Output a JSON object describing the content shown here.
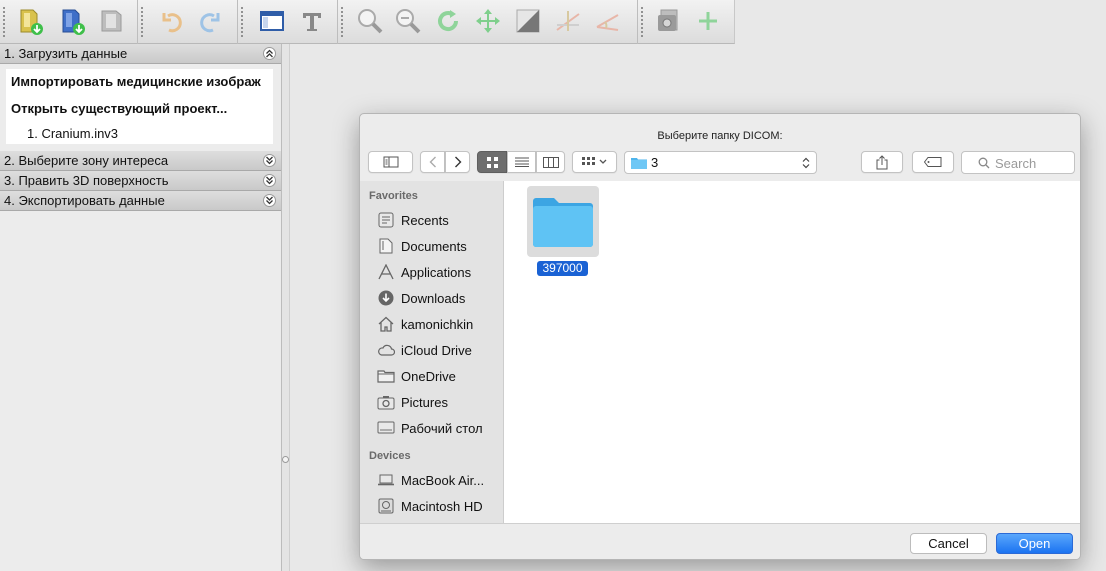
{
  "toolbar": {
    "groups": [
      {
        "icons": [
          "import-images-icon",
          "open-project-icon",
          "save-project-icon"
        ]
      },
      {
        "icons": [
          "undo-icon",
          "redo-icon"
        ]
      },
      {
        "icons": [
          "show-panel-icon",
          "text-icon"
        ]
      },
      {
        "icons": [
          "zoom-in-icon",
          "zoom-out-icon",
          "rotate-icon",
          "pan-icon",
          "contrast-icon",
          "measure-distance-icon",
          "measure-angle-icon"
        ]
      },
      {
        "icons": [
          "screenshot-icon",
          "add-icon"
        ]
      }
    ]
  },
  "sidebar": {
    "sections": [
      {
        "label": "1. Загрузить данные",
        "expanded": true
      },
      {
        "label": "2. Выберите зону интереса",
        "expanded": false
      },
      {
        "label": "3. Править 3D поверхность",
        "expanded": false
      },
      {
        "label": "4. Экспортировать данные",
        "expanded": false
      }
    ],
    "panel1": {
      "import_label": "Импортировать медицинские изображ",
      "open_project_label": "Открыть существующий проект...",
      "recent_file": "1. Cranium.inv3"
    }
  },
  "dialog": {
    "title": "Выберите папку DICOM:",
    "current_folder": "3",
    "search_placeholder": "Search",
    "favorites_header": "Favorites",
    "favorites": [
      {
        "icon": "recents-icon",
        "label": "Recents"
      },
      {
        "icon": "documents-icon",
        "label": "Documents"
      },
      {
        "icon": "applications-icon",
        "label": "Applications"
      },
      {
        "icon": "downloads-icon",
        "label": "Downloads"
      },
      {
        "icon": "home-icon",
        "label": "kamonichkin"
      },
      {
        "icon": "icloud-icon",
        "label": "iCloud Drive"
      },
      {
        "icon": "folder-icon",
        "label": "OneDrive"
      },
      {
        "icon": "camera-icon",
        "label": "Pictures"
      },
      {
        "icon": "desktop-icon",
        "label": "Рабочий стол"
      }
    ],
    "devices_header": "Devices",
    "devices": [
      {
        "icon": "laptop-icon",
        "label": "MacBook Air..."
      },
      {
        "icon": "hard-drive-icon",
        "label": "Macintosh HD"
      }
    ],
    "files": [
      {
        "name": "397000",
        "selected": true
      }
    ],
    "cancel_label": "Cancel",
    "open_label": "Open",
    "accent_color": "#1b73f1"
  }
}
